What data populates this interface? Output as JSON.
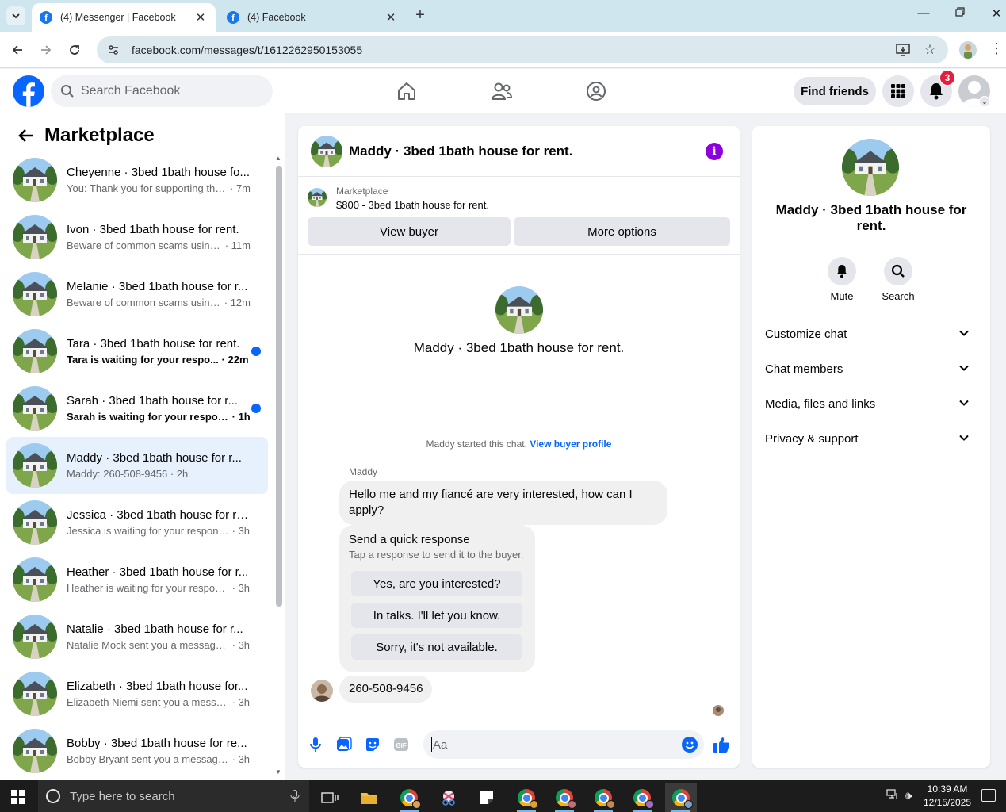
{
  "browser": {
    "tabs": [
      {
        "title": "(4) Messenger | Facebook",
        "active": true
      },
      {
        "title": "(4) Facebook",
        "active": false
      }
    ],
    "url": "facebook.com/messages/t/1612262950153055"
  },
  "header": {
    "search_placeholder": "Search Facebook",
    "find_friends": "Find friends",
    "notification_count": "3",
    "brand_color": "#0866ff"
  },
  "sidebar": {
    "title": "Marketplace",
    "conversations": [
      {
        "name": "Cheyenne · 3bed 1bath house fo...",
        "snippet": "You: Thank you for supporting the ...",
        "time": "7m",
        "unread": false,
        "selected": false
      },
      {
        "name": "Ivon · 3bed 1bath house for rent.",
        "snippet": "Beware of common scams using ...",
        "time": "11m",
        "unread": false,
        "selected": false
      },
      {
        "name": "Melanie · 3bed 1bath house for r...",
        "snippet": "Beware of common scams using ...",
        "time": "12m",
        "unread": false,
        "selected": false
      },
      {
        "name": "Tara · 3bed 1bath house for rent.",
        "snippet": "Tara is waiting for your respo...",
        "time": "22m",
        "unread": true,
        "selected": false
      },
      {
        "name": "Sarah · 3bed 1bath house for r...",
        "snippet": "Sarah is waiting for your respon...",
        "time": "1h",
        "unread": true,
        "selected": false
      },
      {
        "name": "Maddy · 3bed 1bath house for r...",
        "snippet": "Maddy: 260-508-9456",
        "time": "2h",
        "unread": false,
        "selected": true
      },
      {
        "name": "Jessica · 3bed 1bath house for re...",
        "snippet": "Jessica is waiting for your response.",
        "time": "3h",
        "unread": false,
        "selected": false
      },
      {
        "name": "Heather · 3bed 1bath house for r...",
        "snippet": "Heather is waiting for your response.",
        "time": "3h",
        "unread": false,
        "selected": false
      },
      {
        "name": "Natalie · 3bed 1bath house for r...",
        "snippet": "Natalie Mock sent you a message a...",
        "time": "3h",
        "unread": false,
        "selected": false
      },
      {
        "name": "Elizabeth · 3bed 1bath house for...",
        "snippet": "Elizabeth Niemi sent you a messag...",
        "time": "3h",
        "unread": false,
        "selected": false
      },
      {
        "name": "Bobby · 3bed 1bath house for re...",
        "snippet": "Bobby Bryant sent you a message a...",
        "time": "3h",
        "unread": false,
        "selected": false
      }
    ]
  },
  "chat": {
    "title": "Maddy · 3bed 1bath house for rent.",
    "listing": {
      "category": "Marketplace",
      "title": "$800 - 3bed 1bath house for rent.",
      "view_buyer": "View buyer",
      "more_options": "More options"
    },
    "intro_name": "Maddy · 3bed 1bath house for rent.",
    "started_text": "Maddy started this chat.",
    "started_link": "View buyer profile",
    "sender": "Maddy",
    "message1": "Hello me and my fiancé are very interested, how can I apply?",
    "quick": {
      "title": "Send a quick response",
      "subtitle": "Tap a response to send it to the buyer.",
      "options": [
        "Yes, are you interested?",
        "In talks. I'll let you know.",
        "Sorry, it's not available."
      ]
    },
    "message2": "260-508-9456",
    "composer_placeholder": "Aa"
  },
  "right_panel": {
    "name": "Maddy · 3bed 1bath house for rent.",
    "actions": [
      {
        "label": "Mute",
        "icon": "bell-icon"
      },
      {
        "label": "Search",
        "icon": "search-icon"
      }
    ],
    "sections": [
      "Customize chat",
      "Chat members",
      "Media, files and links",
      "Privacy & support"
    ]
  },
  "taskbar": {
    "search_placeholder": "Type here to search",
    "time": "10:39 AM",
    "date": "12/15/2025"
  }
}
